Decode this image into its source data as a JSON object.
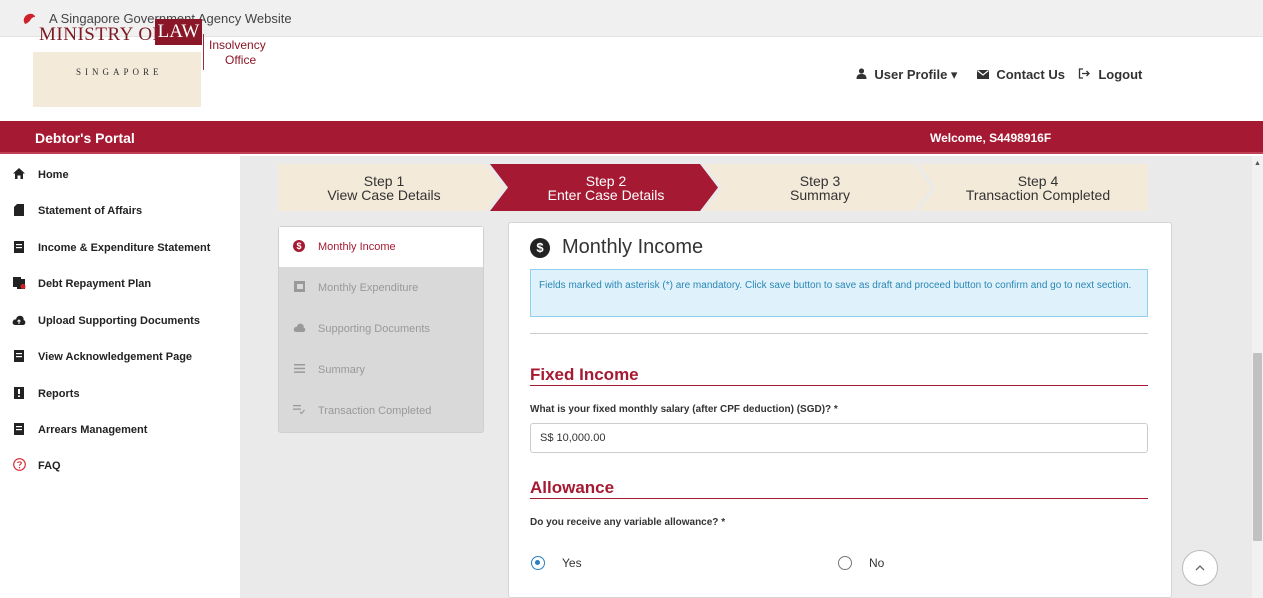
{
  "gov_bar": {
    "text": "A Singapore Government Agency Website"
  },
  "logo": {
    "ministry": "MINISTRY OF",
    "law": "LAW",
    "singapore": "SINGAPORE",
    "io_line1": "Insolvency",
    "io_line2": "Office"
  },
  "top_links": {
    "user_profile": "User Profile ▾",
    "contact_us": "Contact Us",
    "logout": "Logout"
  },
  "portal": {
    "title": "Debtor's Portal",
    "welcome": "Welcome, S4498916F"
  },
  "sidebar": {
    "items": [
      {
        "label": "Home",
        "icon": "home-icon"
      },
      {
        "label": "Statement of Affairs",
        "icon": "folder-icon"
      },
      {
        "label": "Income & Expenditure Statement",
        "icon": "document-icon"
      },
      {
        "label": "Debt Repayment Plan",
        "icon": "files-icon"
      },
      {
        "label": "Upload Supporting Documents",
        "icon": "cloud-upload-icon"
      },
      {
        "label": "View Acknowledgement Page",
        "icon": "document-icon"
      },
      {
        "label": "Reports",
        "icon": "report-icon"
      },
      {
        "label": "Arrears Management",
        "icon": "document-icon"
      },
      {
        "label": "FAQ",
        "icon": "question-icon"
      }
    ]
  },
  "steps": [
    {
      "line1": "Step 1",
      "line2": "View Case Details",
      "active": false
    },
    {
      "line1": "Step 2",
      "line2": "Enter Case Details",
      "active": true
    },
    {
      "line1": "Step 3",
      "line2": "Summary",
      "active": false
    },
    {
      "line1": "Step 4",
      "line2": "Transaction Completed",
      "active": false
    }
  ],
  "left_tabs": [
    {
      "label": "Monthly Income",
      "icon": "dollar-icon",
      "active": true
    },
    {
      "label": "Monthly Expenditure",
      "icon": "expenditure-icon",
      "active": false
    },
    {
      "label": "Supporting Documents",
      "icon": "cloud-icon",
      "active": false
    },
    {
      "label": "Summary",
      "icon": "list-icon",
      "active": false
    },
    {
      "label": "Transaction Completed",
      "icon": "checklist-icon",
      "active": false
    }
  ],
  "form": {
    "title": "Monthly Income",
    "info": "Fields marked with asterisk (*) are mandatory. Click save button to save as draft and proceed button to confirm and go to next section.",
    "fixed_income_title": "Fixed Income",
    "salary_label": "What is your fixed monthly salary (after CPF deduction) (SGD)? *",
    "salary_value": "S$ 10,000.00",
    "allowance_title": "Allowance",
    "allowance_label": "Do you receive any variable allowance? *",
    "yes": "Yes",
    "no": "No",
    "selected": "Yes"
  },
  "colors": {
    "brand_red": "#a51a32",
    "step_beige": "#f3ead9",
    "info_blue": "#dff2fb",
    "radio_blue": "#2a7fc1"
  }
}
